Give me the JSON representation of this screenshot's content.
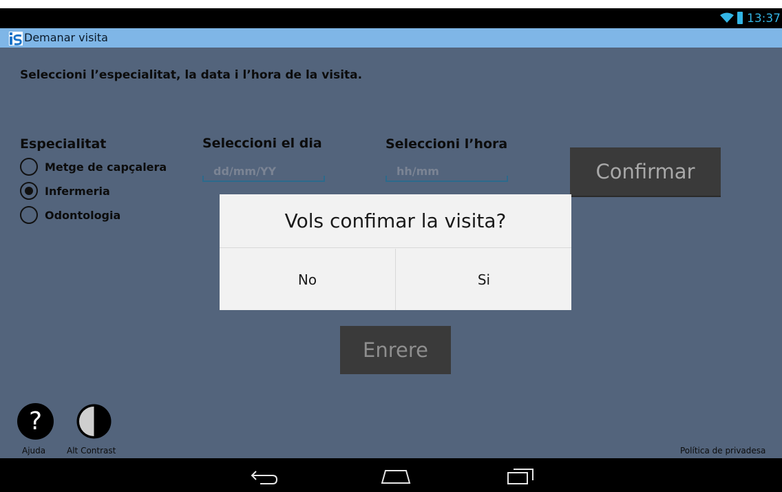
{
  "status_bar": {
    "time": "13:37",
    "icons": [
      "wifi-icon",
      "battery-icon"
    ],
    "accent_color": "#33b5e5"
  },
  "title_bar": {
    "app_icon": "app-logo-icon",
    "title": "Demanar visita",
    "background_color": "#7fb6e7"
  },
  "main": {
    "background_color": "#53647c",
    "instruction": "Seleccioni l’especialitat, la data i l’hora de la visita.",
    "especialitat": {
      "label": "Especialitat",
      "options": [
        {
          "label": "Metge de capçalera",
          "checked": false
        },
        {
          "label": "Infermeria",
          "checked": true
        },
        {
          "label": "Odontologia",
          "checked": false
        }
      ]
    },
    "dia": {
      "label": "Seleccioni el dia",
      "placeholder": "dd/mm/YY",
      "value": ""
    },
    "hora": {
      "label": "Seleccioni l’hora",
      "placeholder": "hh/mm",
      "value": ""
    },
    "confirm_button": "Confirmar",
    "back_button": "Enrere"
  },
  "dialog": {
    "message": "Vols confimar la visita?",
    "no_button": "No",
    "yes_button": "Si"
  },
  "footer": {
    "help_label": "Ajuda",
    "help_icon_glyph": "?",
    "contrast_label": "Alt Contrast",
    "privacy_link": "Política de privadesa"
  },
  "nav_bar": {
    "buttons": [
      "back-icon",
      "home-icon",
      "recent-apps-icon"
    ]
  }
}
